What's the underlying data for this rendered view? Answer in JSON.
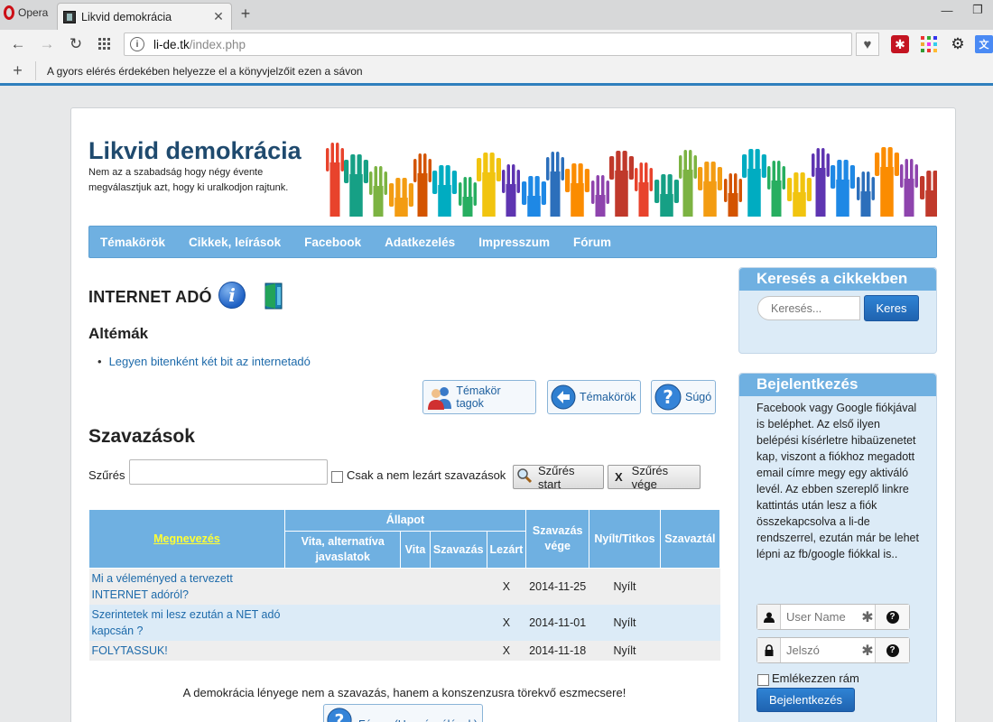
{
  "browser": {
    "menu_label": "Opera",
    "tab_title": "Likvid demokrácia",
    "address_host": "li-de.tk",
    "address_path": "/index.php",
    "bookmark_hint": "A gyors elérés érdekében helyezze el a könyvjelzőit ezen a sávon"
  },
  "site": {
    "title": "Likvid demokrácia",
    "slogan": "Nem az a szabadság hogy négy évente megválasztjuk azt, hogy ki uralkodjon rajtunk.",
    "menu": [
      "Témakörök",
      "Cikkek, leírások",
      "Facebook",
      "Adatkezelés",
      "Impresszum",
      "Fórum"
    ]
  },
  "topic": {
    "title": "INTERNET ADÓ",
    "subtopics_title": "Altémák",
    "subtopics": [
      "Legyen bitenként két bit az internetadó"
    ],
    "buttons": {
      "members": "Témakör tagok",
      "topics": "Témakörök",
      "help": "Súgó"
    }
  },
  "votes": {
    "title": "Szavazások",
    "filter_label": "Szűrés",
    "filter_value": "",
    "open_only_label": "Csak a nem lezárt szavazások",
    "filter_start": "Szűrés start",
    "filter_end": "Szűrés vége",
    "headers": {
      "name": "Megnevezés",
      "state": "Állapot",
      "debate_alt": "Vita, alternatíva javaslatok",
      "debate": "Vita",
      "voting": "Szavazás",
      "closed": "Lezárt",
      "vote_end": "Szavazás vége",
      "open_secret": "Nyílt/Titkos",
      "abstain": "Szavaztál"
    },
    "rows": [
      {
        "name": "Mi a véleményed a tervezett INTERNET adóról?",
        "closed": "X",
        "end": "2014-11-25",
        "type": "Nyílt"
      },
      {
        "name": "Szerintetek mi lesz ezután a NET adó kapcsán ?",
        "closed": "X",
        "end": "2014-11-01",
        "type": "Nyílt"
      },
      {
        "name": "FOLYTASSUK!",
        "closed": "X",
        "end": "2014-11-18",
        "type": "Nyílt"
      }
    ],
    "quote": "A demokrácia lényege nem a szavazás, hanem a konszenzusra törekvő eszmecsere!",
    "forum_button": "Fórum (Hozzászólások)"
  },
  "sidebar": {
    "search": {
      "title": "Keresés a cikkekben",
      "placeholder": "Keresés...",
      "button": "Keres"
    },
    "login": {
      "title": "Bejelentkezés",
      "text": "Facebook vagy Google fiókjával is beléphet. Az első ilyen belépési kísérletre hibaüzenetet kap, viszont a fiókhoz megadott email címre megy egy aktiváló levél. Az ebben szereplő linkre kattintás után lesz a fiók összekapcsolva a li-de rendszerrel, ezután már be lehet lépni az fb/google fiókkal is..",
      "username_placeholder": "User Name",
      "password_placeholder": "Jelszó",
      "remember": "Emlékezzen rám",
      "button": "Bejelentkezés"
    }
  },
  "colors": {
    "accent": "#6fb0e1",
    "title": "#1f4a6e",
    "link": "#1d6aaa",
    "browser_accent": "#2f7fbd"
  }
}
